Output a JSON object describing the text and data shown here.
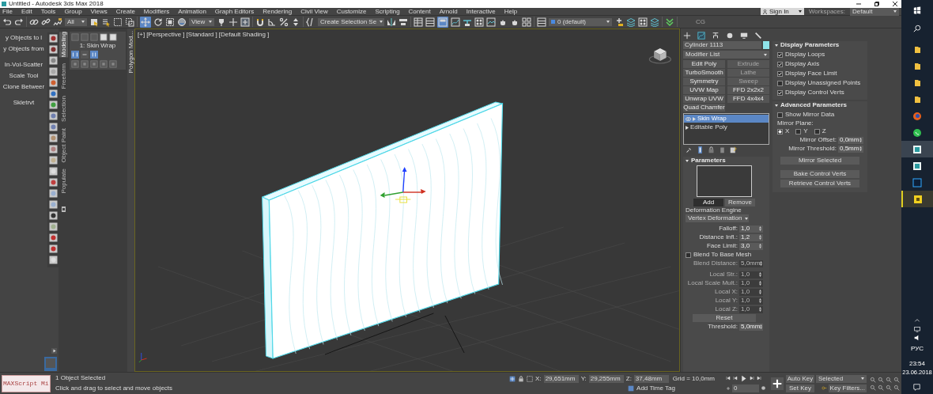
{
  "window": {
    "title": "Untitled - Autodesk 3ds Max 2018"
  },
  "menu": [
    "File",
    "Edit",
    "Tools",
    "Group",
    "Views",
    "Create",
    "Modifiers",
    "Animation",
    "Graph Editors",
    "Rendering",
    "Civil View",
    "Customize",
    "Scripting",
    "Content",
    "Arnold",
    "Interactive",
    "Help"
  ],
  "account": {
    "sign_in": "Sign In",
    "workspaces_label": "Workspaces:",
    "workspace": "Default"
  },
  "toolbar": {
    "filter": "All",
    "coord_system": "View",
    "selection_set": "Create Selection Se",
    "layer": "0 (default)",
    "label": "CG"
  },
  "script_buttons": [
    "y Objects to l",
    "y Objects from",
    "In-Vol-Scatter",
    "Scale Tool",
    "Clone Betweer",
    "Skletrvt"
  ],
  "ribbon": {
    "tabs": [
      {
        "label": "Modeling",
        "selected": true
      },
      {
        "label": "Freeform",
        "selected": false
      },
      {
        "label": "Selection",
        "selected": false
      },
      {
        "label": "Object Paint",
        "selected": false
      },
      {
        "label": "Populate",
        "selected": false
      }
    ],
    "modifier": "1: Skin Wrap",
    "side_label": "Polygon Mod..."
  },
  "viewport": {
    "labels": [
      "[+]",
      "[Perspective ]",
      "[Standard ]",
      "[Default Shading ]"
    ]
  },
  "command_panel": {
    "object_name": "Cylinder 1113",
    "modifier_list": "Modifier List",
    "modifier_buttons": [
      {
        "label": "Edit Poly",
        "disabled": false
      },
      {
        "label": "Extrude",
        "disabled": true
      },
      {
        "label": "TurboSmooth",
        "disabled": false
      },
      {
        "label": "Lathe",
        "disabled": true
      },
      {
        "label": "Symmetry",
        "disabled": false
      },
      {
        "label": "Sweep",
        "disabled": true
      },
      {
        "label": "UVW Map",
        "disabled": false
      },
      {
        "label": "FFD 2x2x2",
        "disabled": false
      },
      {
        "label": "Unwrap UVW",
        "disabled": false
      },
      {
        "label": "FFD 4x4x4",
        "disabled": false
      },
      {
        "label": "Quad Chamfer",
        "disabled": false
      }
    ],
    "stack": [
      {
        "label": "Skin Wrap",
        "selected": true
      },
      {
        "label": "Editable Poly",
        "selected": false
      }
    ]
  },
  "parameters": {
    "title": "Parameters",
    "add": {
      "label": "Add",
      "selected": true
    },
    "remove": {
      "label": "Remove",
      "selected": false
    },
    "engine_label": "Deformation Engine",
    "engine": "Vertex Deformation",
    "spinners": [
      {
        "label": "Falloff:",
        "value": "1,0",
        "disabled": false
      },
      {
        "label": "Distance Infl.:",
        "value": "1,2",
        "disabled": false
      },
      {
        "label": "Face Limit:",
        "value": "3,0",
        "disabled": false
      }
    ],
    "blend": {
      "label": "Blend To Base Mesh",
      "checked": false
    },
    "blend_spinners": [
      {
        "label": "Blend Distance:",
        "value": "5,0mm",
        "disabled": true
      }
    ],
    "local_spinners": [
      {
        "label": "Local Str.:",
        "value": "1,0",
        "disabled": true
      },
      {
        "label": "Local Scale Mult.:",
        "value": "1,0",
        "disabled": true
      },
      {
        "label": "Local X:",
        "value": "1,0",
        "disabled": true
      },
      {
        "label": "Local Y:",
        "value": "1,0",
        "disabled": true
      },
      {
        "label": "Local Z:",
        "value": "1,0",
        "disabled": true
      }
    ],
    "reset": "Reset",
    "threshold": {
      "label": "Threshold:",
      "value": "5,0mm",
      "disabled": false
    }
  },
  "display_parameters": {
    "title": "Display Parameters",
    "options": [
      {
        "label": "Display Loops",
        "checked": true
      },
      {
        "label": "Display Axis",
        "checked": true
      },
      {
        "label": "Display Face Limit",
        "checked": true
      },
      {
        "label": "Display Unassigned Points",
        "checked": false
      },
      {
        "label": "Display Control Verts",
        "checked": true
      }
    ]
  },
  "advanced_parameters": {
    "title": "Advanced Parameters",
    "show_mirror": {
      "label": "Show Mirror Data",
      "checked": false
    },
    "plane_label": "Mirror Plane:",
    "planes": [
      {
        "label": "X",
        "selected": true
      },
      {
        "label": "Y",
        "selected": false
      },
      {
        "label": "Z",
        "selected": false
      }
    ],
    "spinners": [
      {
        "label": "Mirror Offset:",
        "value": "0,0mm",
        "disabled": false
      },
      {
        "label": "Mirror Threshold:",
        "value": "0,5mm",
        "disabled": false
      }
    ],
    "buttons": [
      "Mirror Selected",
      "Bake Control Verts",
      "Retrieve Control Verts"
    ]
  },
  "status_bar": {
    "maxscript": "MAXScript Mi",
    "selection": "1 Object Selected",
    "prompt": "Click and drag to select and move objects",
    "coords": [
      {
        "axis": "X:",
        "value": "29,651mm"
      },
      {
        "axis": "Y:",
        "value": "29,255mm"
      },
      {
        "axis": "Z:",
        "value": "37,48mm"
      }
    ],
    "grid": "Grid = 10,0mm",
    "time_tag": "Add Time Tag",
    "frame": "0",
    "auto_key": "Auto Key",
    "key_mode": "Selected",
    "set_key": "Set Key",
    "key_filters": "Key Filters..."
  },
  "taskbar": {
    "language": "РУС",
    "time": "23:54",
    "date": "23.06.2018"
  }
}
